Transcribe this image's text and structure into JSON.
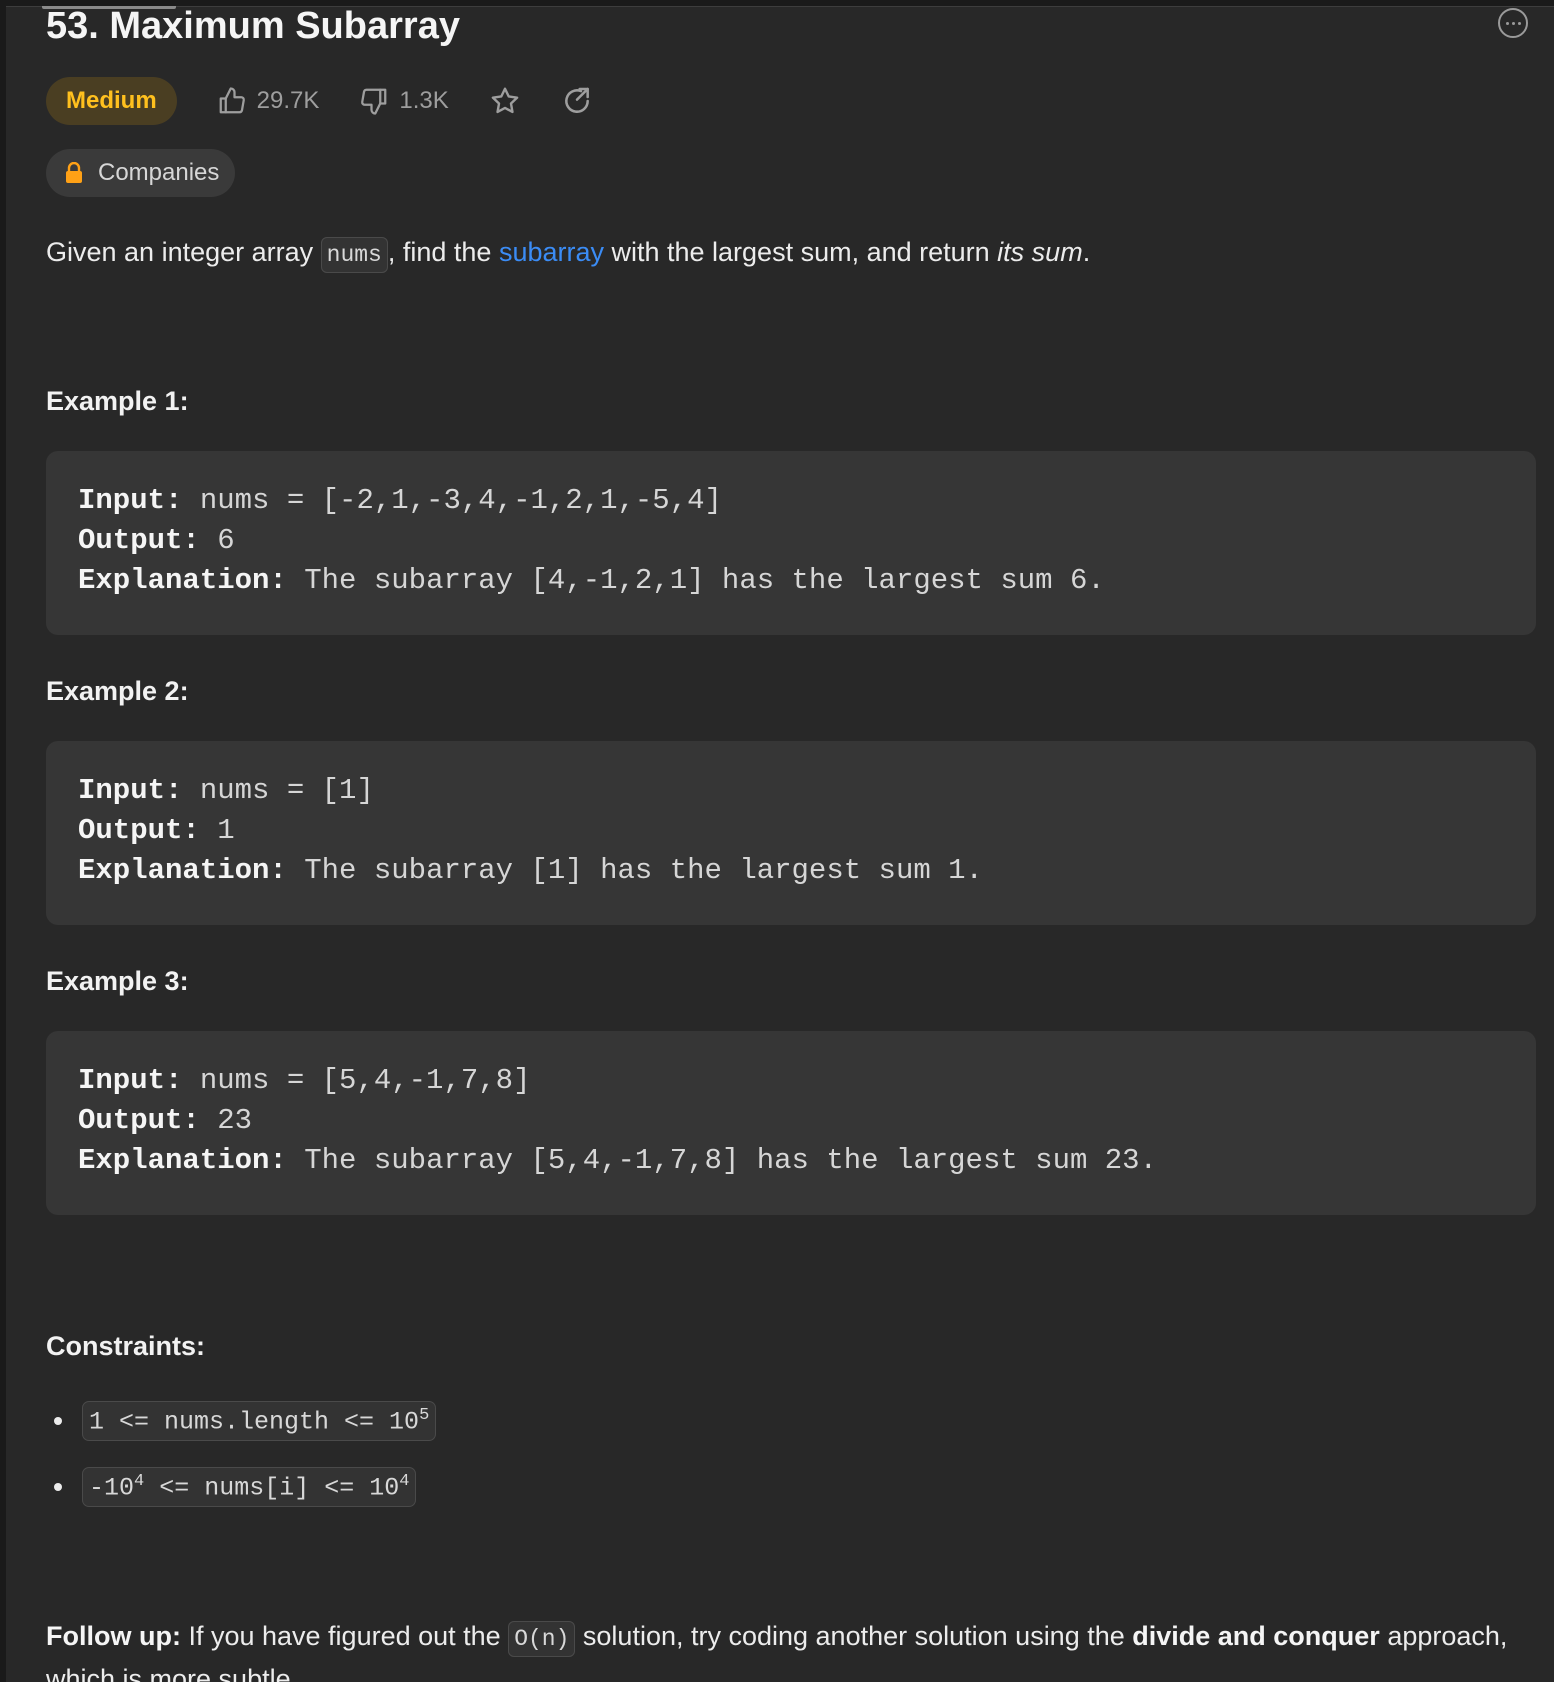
{
  "problem": {
    "title": "53. Maximum Subarray",
    "difficulty": "Medium",
    "likes": "29.7K",
    "dislikes": "1.3K",
    "companies_label": "Companies"
  },
  "description": {
    "part1": "Given an integer array ",
    "code_nums": "nums",
    "part2": ", find the ",
    "link_text": "subarray",
    "part3": " with the largest sum, and return ",
    "italic": "its sum",
    "part4": "."
  },
  "examples": [
    {
      "title": "Example 1:",
      "input_label": "Input:",
      "input_value": " nums = [-2,1,-3,4,-1,2,1,-5,4]",
      "output_label": "Output:",
      "output_value": " 6",
      "explanation_label": "Explanation:",
      "explanation_value": " The subarray [4,-1,2,1] has the largest sum 6."
    },
    {
      "title": "Example 2:",
      "input_label": "Input:",
      "input_value": " nums = [1]",
      "output_label": "Output:",
      "output_value": " 1",
      "explanation_label": "Explanation:",
      "explanation_value": " The subarray [1] has the largest sum 1."
    },
    {
      "title": "Example 3:",
      "input_label": "Input:",
      "input_value": " nums = [5,4,-1,7,8]",
      "output_label": "Output:",
      "output_value": " 23",
      "explanation_label": "Explanation:",
      "explanation_value": " The subarray [5,4,-1,7,8] has the largest sum 23."
    }
  ],
  "constraints": {
    "title": "Constraints:",
    "c1_a": "1 <= nums.length <= 10",
    "c1_sup": "5",
    "c2_a": "-10",
    "c2_sup1": "4",
    "c2_b": " <= nums[i] <= 10",
    "c2_sup2": "4"
  },
  "followup": {
    "label": "Follow up:",
    "part1": " If you have figured out the ",
    "code": "O(n)",
    "part2": " solution, try coding another solution using the ",
    "bold": "divide and conquer",
    "part3": " approach, which is more subtle."
  },
  "colors": {
    "background": "#282828",
    "difficulty_text": "#ffc01e",
    "difficulty_bg": "#4a3e22",
    "link": "#3b8cf5",
    "lock": "#ffa116"
  },
  "icons": [
    "more-icon",
    "thumbs-up-icon",
    "thumbs-down-icon",
    "star-icon",
    "share-icon",
    "lock-icon"
  ]
}
